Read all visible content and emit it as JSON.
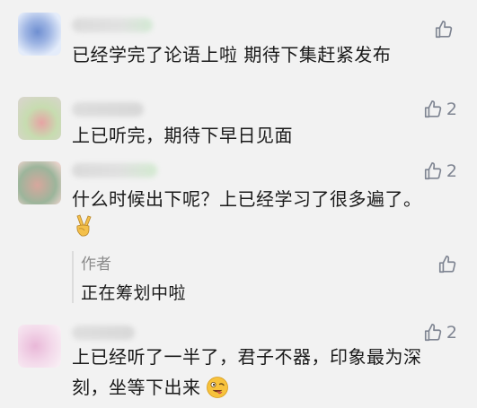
{
  "comments": [
    {
      "text": "已经学完了论语上啦  期待下集赶紧发布",
      "likes": "",
      "avatar_colors": [
        "#b9c9ea",
        "#6f8fd1",
        "#e4ecfa"
      ],
      "name_colors": [
        "#d4d4d4",
        "#c8e6c9"
      ]
    },
    {
      "text": "上已听完，期待下早日见面",
      "likes": "2",
      "avatar_colors": [
        "#c7dcb0",
        "#e0a0a0",
        "#d6d6c8"
      ],
      "name_colors": [
        "#d6d6d6",
        "#cfcfcf"
      ]
    },
    {
      "text_line1": "什么时候出下呢？上已经学习了很多遍了。",
      "likes": "2",
      "emoji": "victory-hand",
      "avatar_colors": [
        "#d7a79d",
        "#9cb59b",
        "#e9d3cc"
      ],
      "name_colors": [
        "#d3d3d3",
        "#c9e8c6"
      ],
      "reply": {
        "author": "作者",
        "text": "正在筹划中啦"
      }
    },
    {
      "text_line1": "上已经听了一半了，君子不器，印象最为深",
      "text_line2": "刻，坐等下出来",
      "likes": "2",
      "emoji": "winking-face-with-tongue",
      "avatar_colors": [
        "#f3d9ea",
        "#e9b8d8",
        "#f8eef4"
      ],
      "name_colors": [
        "#d8d8d8",
        "#d0d0d0"
      ]
    }
  ],
  "colors": {
    "background": "#f2f2f2",
    "text": "#1a1a1a",
    "secondary": "#8b8b8b",
    "icon": "#7f8592"
  }
}
